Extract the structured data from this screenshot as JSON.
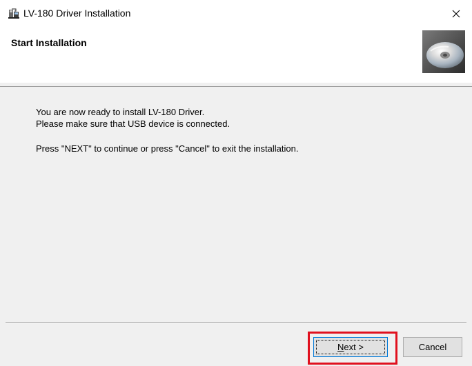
{
  "window": {
    "title": "LV-180 Driver Installation",
    "close_symbol": "×"
  },
  "header": {
    "title": "Start Installation",
    "art_icon": "cd-disc-icon"
  },
  "body": {
    "line1": "You are now ready to install LV-180 Driver.",
    "line2": "Please make sure that USB device is connected.",
    "line3": "Press \"NEXT\" to continue or press \"Cancel\" to exit the installation."
  },
  "buttons": {
    "next_mnemonic": "N",
    "next_rest": "ext >",
    "cancel_label": "Cancel"
  },
  "colors": {
    "highlight": "#e0101e",
    "focus_border": "#0078d7"
  }
}
